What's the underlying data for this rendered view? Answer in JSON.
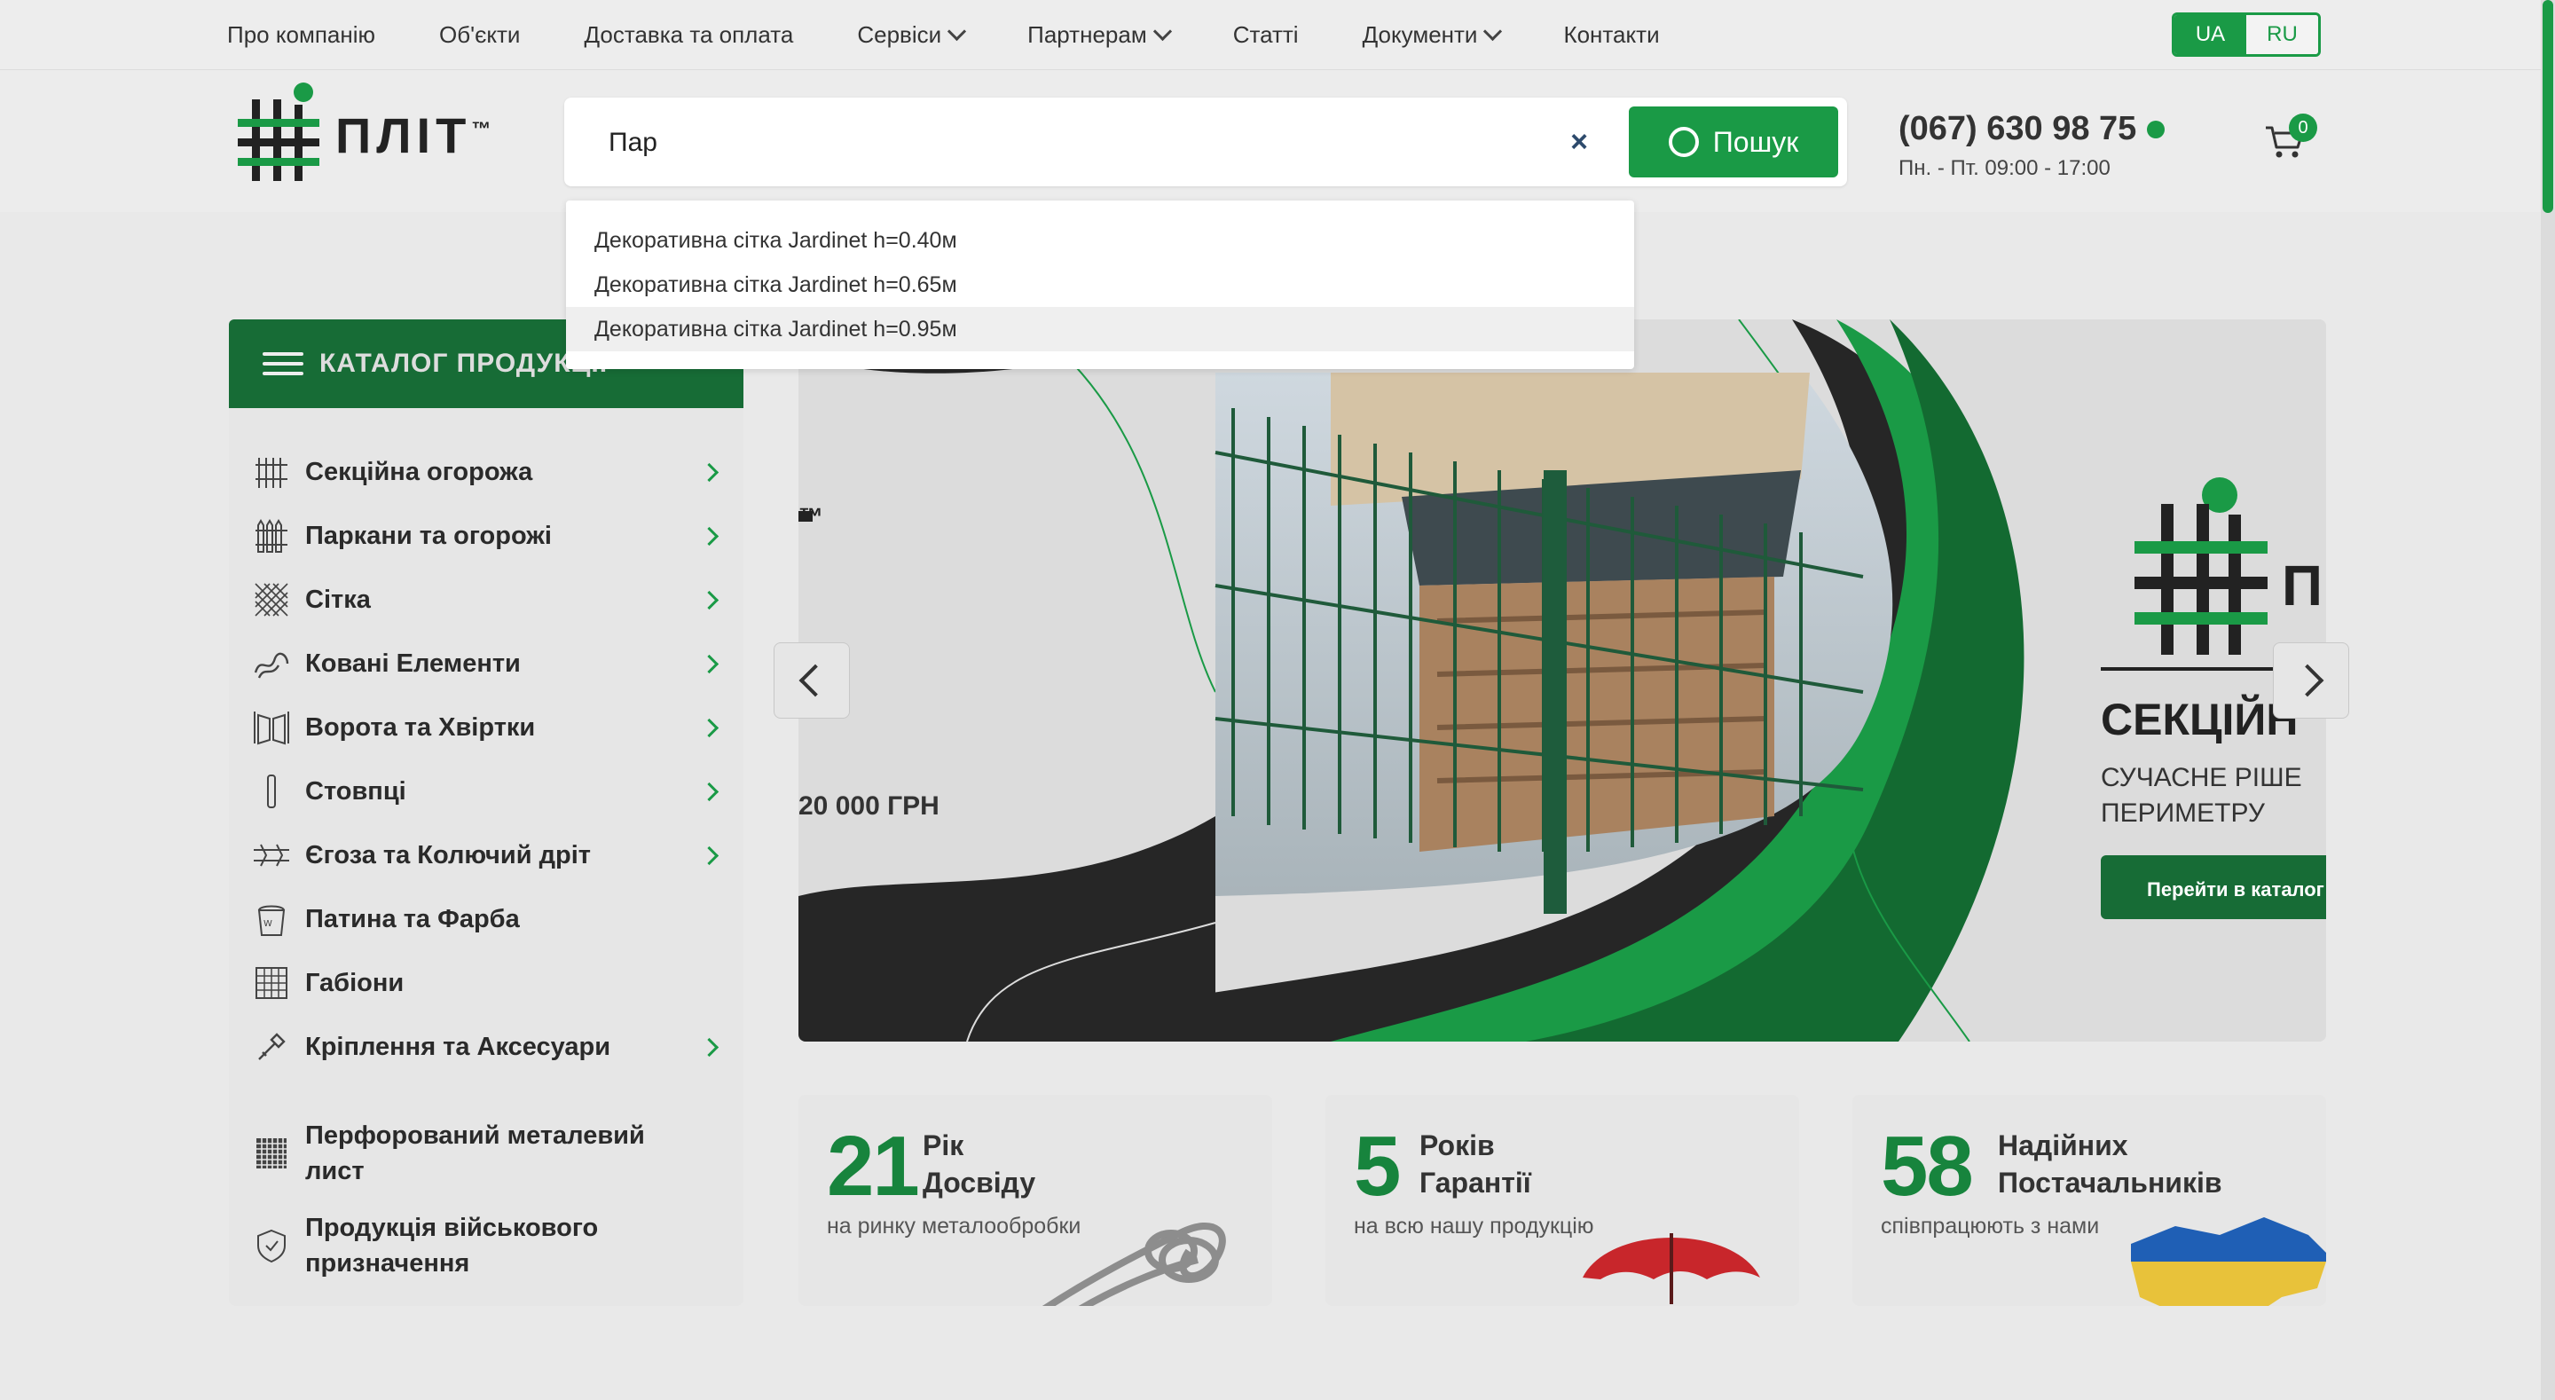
{
  "topnav": {
    "items": [
      {
        "label": "Про компанію",
        "dropdown": false
      },
      {
        "label": "Об'єкти",
        "dropdown": false
      },
      {
        "label": "Доставка та оплата",
        "dropdown": false
      },
      {
        "label": "Сервіси",
        "dropdown": true
      },
      {
        "label": "Партнерам",
        "dropdown": true
      },
      {
        "label": "Статті",
        "dropdown": false
      },
      {
        "label": "Документи",
        "dropdown": true
      },
      {
        "label": "Контакти",
        "dropdown": false
      }
    ],
    "lang": {
      "active": "UA",
      "inactive": "RU"
    }
  },
  "logo": {
    "text": "ПЛІТ",
    "tm": "™"
  },
  "search": {
    "value": "Пар",
    "clear": "×",
    "button_label": "Пошук",
    "suggestions": [
      "Декоративна сітка Jardinet h=0.40м",
      "Декоративна сітка Jardinet h=0.65м",
      "Декоративна сітка Jardinet h=0.95м"
    ],
    "highlighted_index": 2
  },
  "contact": {
    "phone": "(067) 630 98 75",
    "hours": "Пн. - Пт. 09:00 - 17:00"
  },
  "cart": {
    "count": "0"
  },
  "catalog": {
    "title": "КАТАЛОГ ПРОДУКЦІЇ",
    "items": [
      {
        "label": "Секційна огорожа",
        "icon": "sectional-fence-icon",
        "has_sub": true
      },
      {
        "label": "Паркани та огорожі",
        "icon": "fence-icon",
        "has_sub": true
      },
      {
        "label": "Сітка",
        "icon": "mesh-icon",
        "has_sub": true
      },
      {
        "label": "Ковані Елементи",
        "icon": "forged-elements-icon",
        "has_sub": true
      },
      {
        "label": "Ворота та Хвіртки",
        "icon": "gate-icon",
        "has_sub": true
      },
      {
        "label": "Стовпці",
        "icon": "post-icon",
        "has_sub": true
      },
      {
        "label": "Єгоза та Колючий дріт",
        "icon": "barbed-wire-icon",
        "has_sub": true
      },
      {
        "label": "Патина та Фарба",
        "icon": "paint-bucket-icon",
        "has_sub": false
      },
      {
        "label": "Габіони",
        "icon": "gabion-icon",
        "has_sub": false
      },
      {
        "label": "Кріплення та Аксесуари",
        "icon": "fastener-icon",
        "has_sub": true
      },
      {
        "label": "Перфорований металевий лист",
        "icon": "perforated-sheet-icon",
        "has_sub": false
      },
      {
        "label": "Продукція військового призначення",
        "icon": "shield-icon",
        "has_sub": false
      }
    ]
  },
  "banner": {
    "tm_text": "™",
    "price_text": "20 000 ГРН",
    "brand_text": "П",
    "headline": "СЕКЦІЙН",
    "sub_line1": "СУЧАСНЕ РІШЕ",
    "sub_line2": "ПЕРИМЕТРУ",
    "cta": "Перейти в каталог"
  },
  "stats": [
    {
      "number": "21",
      "title_line1": "Рік",
      "title_line2": "Досвіду",
      "sub": "на ринку металообробки"
    },
    {
      "number": "5",
      "title_line1": "Років",
      "title_line2": "Гарантії",
      "sub": "на всю нашу продукцію"
    },
    {
      "number": "58",
      "title_line1": "Надійних",
      "title_line2": "Постачальників",
      "sub": "співпрацюють з нами"
    }
  ]
}
